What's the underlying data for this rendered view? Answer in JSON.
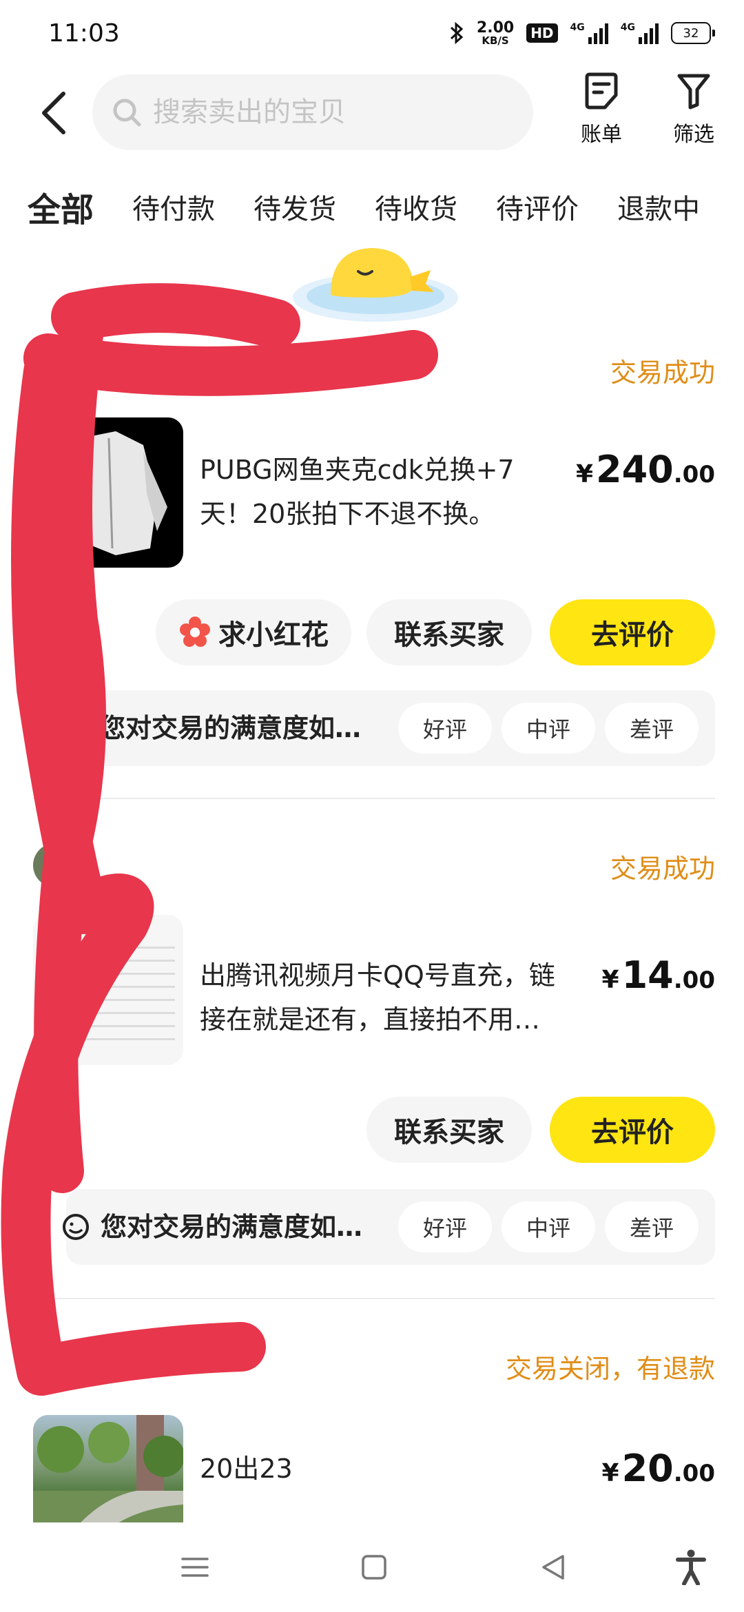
{
  "status_bar": {
    "time": "11:03",
    "net_speed_value": "2.00",
    "net_speed_unit": "KB/S",
    "hd_badge": "HD",
    "sim1_label": "4G",
    "sim2_label": "4G",
    "battery": "32"
  },
  "header": {
    "search_placeholder": "搜索卖出的宝贝",
    "bill_label": "账单",
    "filter_label": "筛选"
  },
  "tabs": [
    "全部",
    "待付款",
    "待发货",
    "待收货",
    "待评价",
    "退款中"
  ],
  "active_tab": "全部",
  "orders": [
    {
      "status": "交易成功",
      "title": "PUBG网鱼夹克cdk兑换+7天！20张拍下不退不换。",
      "price_currency": "¥",
      "price_int": "240",
      "price_dec": ".00",
      "actions": [
        "求小红花",
        "联系买家",
        "去评价"
      ],
      "feedback_question": "您对交易的满意度如…",
      "ratings": [
        "好评",
        "中评",
        "差评"
      ]
    },
    {
      "status": "交易成功",
      "title": "出腾讯视频月卡QQ号直充，链接在就是还有，直接拍不用…",
      "price_currency": "¥",
      "price_int": "14",
      "price_dec": ".00",
      "actions": [
        "联系买家",
        "去评价"
      ],
      "feedback_question": "您对交易的满意度如…",
      "ratings": [
        "好评",
        "中评",
        "差评"
      ]
    },
    {
      "status": "交易关闭，有退款",
      "title": "20出23",
      "price_currency": "¥",
      "price_int": "20",
      "price_dec": ".00"
    }
  ],
  "colors": {
    "accent_yellow": "#ffe512",
    "status_orange": "#e08d17",
    "scribble_red": "#e8364c"
  },
  "icons": {
    "back": "chevron-left-icon",
    "search": "search-icon",
    "bill": "bill-icon",
    "filter": "filter-icon",
    "flower": "flower-icon",
    "nav_menu": "menu-icon",
    "nav_home": "square-icon",
    "nav_back": "triangle-back-icon",
    "nav_accessibility": "accessibility-icon"
  }
}
